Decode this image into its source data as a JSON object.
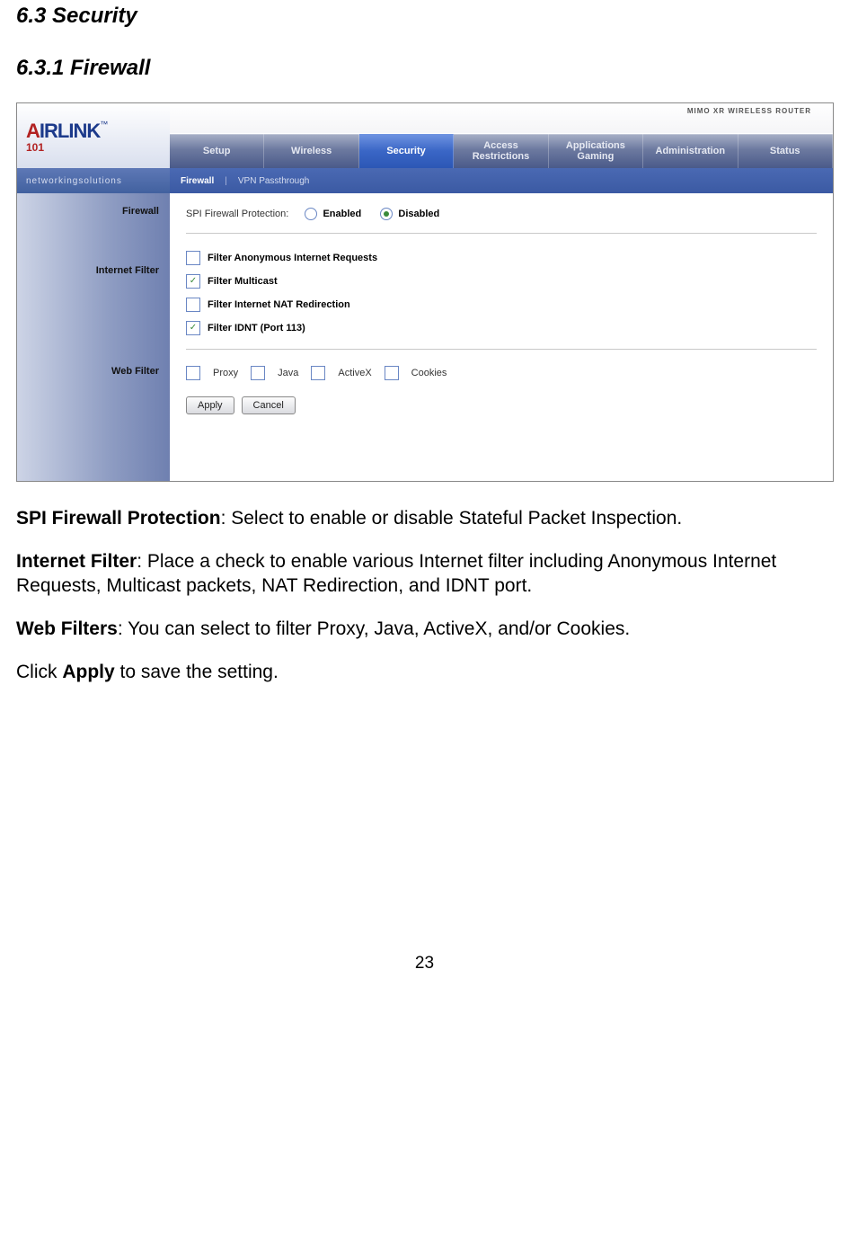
{
  "headings": {
    "section": "6.3 Security",
    "subsection": "6.3.1 Firewall"
  },
  "router_ui": {
    "logo": {
      "a": "A",
      "irlink": "IRLINK",
      "tm": "™",
      "sub": "101"
    },
    "mimo_badge": "MIMO XR\nWIRELESS ROUTER",
    "tabs": [
      "Setup",
      "Wireless",
      "Security",
      "Access\nRestrictions",
      "Applications\nGaming",
      "Administration",
      "Status"
    ],
    "active_tab_index": 2,
    "subbar_left": "networkingsolutions",
    "subtabs": [
      "Firewall",
      "VPN Passthrough"
    ],
    "active_subtab_index": 0,
    "sidebar": {
      "s1": "Firewall",
      "s2": "Internet Filter",
      "s3": "Web Filter"
    },
    "spi": {
      "label": "SPI Firewall Protection:",
      "enabled_label": "Enabled",
      "disabled_label": "Disabled",
      "selected": "disabled"
    },
    "filters": {
      "f1": {
        "label": "Filter Anonymous Internet Requests",
        "checked": false
      },
      "f2": {
        "label": "Filter Multicast",
        "checked": true
      },
      "f3": {
        "label": "Filter Internet NAT Redirection",
        "checked": false
      },
      "f4": {
        "label": "Filter IDNT (Port 113)",
        "checked": true
      }
    },
    "webfilters": {
      "w1": {
        "label": "Proxy",
        "checked": false
      },
      "w2": {
        "label": "Java",
        "checked": false
      },
      "w3": {
        "label": "ActiveX",
        "checked": false
      },
      "w4": {
        "label": "Cookies",
        "checked": false
      }
    },
    "buttons": {
      "apply": "Apply",
      "cancel": "Cancel"
    }
  },
  "descriptions": {
    "spi_bold": "SPI Firewall Protection",
    "spi_rest": ": Select to enable or disable Stateful Packet Inspection.",
    "if_bold": "Internet Filter",
    "if_rest": ": Place a check to enable various Internet filter including Anonymous Internet Requests, Multicast packets, NAT Redirection, and IDNT port.",
    "wf_bold": "Web Filters",
    "wf_rest": ": You can select to filter Proxy, Java, ActiveX, and/or Cookies.",
    "apply_pre": "Click ",
    "apply_bold": "Apply",
    "apply_post": " to save the setting."
  },
  "page_number": "23"
}
